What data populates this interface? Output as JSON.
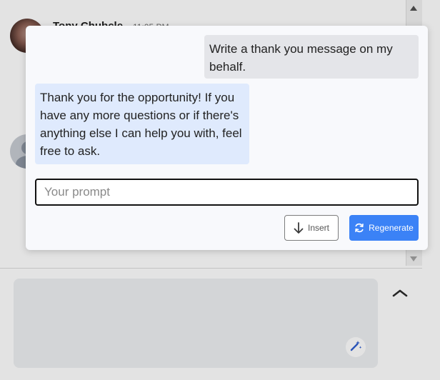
{
  "background": {
    "sender_name": "Tony Chubcle",
    "time": "11:05 PM"
  },
  "dialog": {
    "user_message": "Write a thank you message on my behalf.",
    "assistant_message": "Thank you for the opportunity! If you have any more questions or if there's anything else I can help you with, feel free to ask.",
    "prompt": {
      "value": "",
      "placeholder": "Your prompt"
    },
    "insert_label": "Insert",
    "regenerate_label": "Regenerate"
  },
  "icons": {
    "insert": "arrow-down-icon",
    "regenerate": "refresh-icon",
    "collapse": "chevron-up-icon",
    "magic": "magic-wand-icon"
  },
  "colors": {
    "accent": "#3b82f6",
    "user_bubble": "#e4e5e9",
    "assistant_bubble": "#dfeafd"
  }
}
